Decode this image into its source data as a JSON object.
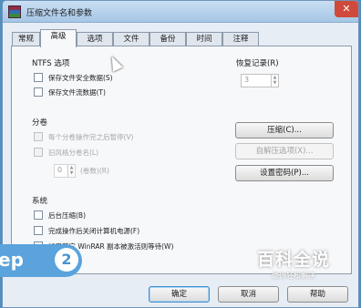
{
  "window": {
    "title": "压缩文件名和参数"
  },
  "tabs": [
    "常规",
    "高级",
    "选项",
    "文件",
    "备份",
    "时间",
    "注释"
  ],
  "ntfs": {
    "label": "NTFS 选项",
    "items": [
      "保存文件安全数据(S)",
      "保存文件流数据(T)"
    ]
  },
  "volume": {
    "label": "分卷",
    "items": [
      "每个分卷操作完之后暂停(V)",
      "旧风格分卷名(L)"
    ],
    "spinner_value": "0",
    "spinner_label": "(卷数)(R)"
  },
  "recovery": {
    "label": "恢复记录(R)",
    "value": "3"
  },
  "buttons": {
    "compress": "压缩(C)...",
    "sfx": "自解压选项(X)...",
    "password": "设置密码(P)...",
    "ok": "确定",
    "cancel": "取消",
    "help": "帮助"
  },
  "system": {
    "label": "系统",
    "items": [
      "后台压缩(B)",
      "完成操作后关闭计算机电源(F)",
      "如果其它 WinRAR 副本被激活则等待(W)"
    ]
  },
  "overlay": {
    "step_text": "ep",
    "step_number": "2",
    "watermark_main": "百科全说",
    "watermark_sub": "助你轻松解决"
  }
}
